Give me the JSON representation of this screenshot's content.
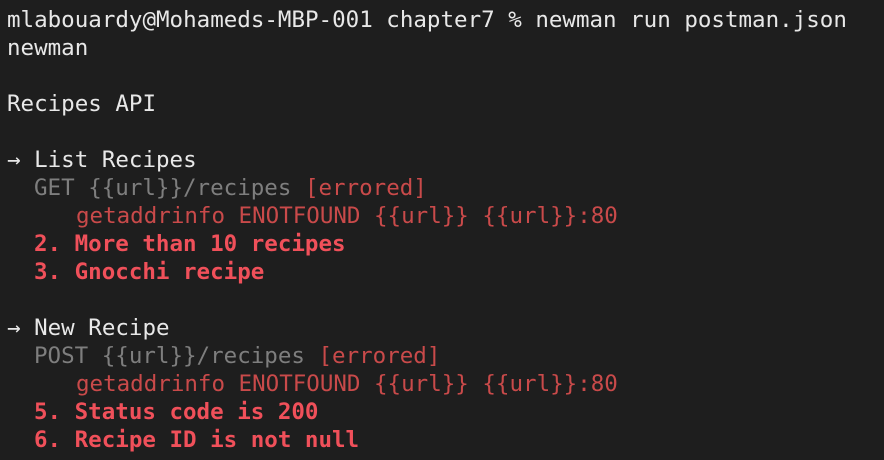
{
  "prompt": {
    "user_host": "mlabouardy@Mohameds-MBP-001",
    "cwd": "chapter7",
    "symbol": "%",
    "command": "newman run postman.json"
  },
  "output": {
    "tool": "newman",
    "collection": "Recipes API",
    "requests": [
      {
        "arrow": "→",
        "name": "List Recipes",
        "method": "GET",
        "url": "{{url}}/recipes",
        "status": "[errored]",
        "error": "getaddrinfo ENOTFOUND {{url}} {{url}}:80",
        "failures": [
          "2. More than 10 recipes",
          "3. Gnocchi recipe"
        ]
      },
      {
        "arrow": "→",
        "name": "New Recipe",
        "method": "POST",
        "url": "{{url}}/recipes",
        "status": "[errored]",
        "error": "getaddrinfo ENOTFOUND {{url}} {{url}}:80",
        "failures": [
          "5. Status code is 200",
          "6. Recipe ID is not null"
        ]
      }
    ]
  },
  "colors": {
    "background": "#1e1e1e",
    "text": "#e8e8e8",
    "muted": "#7e7e7e",
    "error": "#c94a4a",
    "failure": "#f0505a"
  }
}
